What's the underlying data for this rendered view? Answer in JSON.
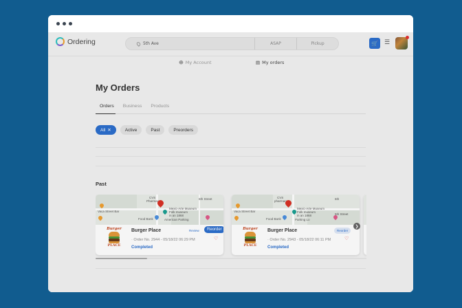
{
  "brand": {
    "name": "Ordering"
  },
  "search": {
    "address": "5th Ave",
    "time": "ASAP",
    "mode": "Pickup"
  },
  "account_nav": {
    "my_account": "My Account",
    "my_orders": "My orders"
  },
  "page_title": "My Orders",
  "tabs": [
    {
      "label": "Orders"
    },
    {
      "label": "Business"
    },
    {
      "label": "Products"
    }
  ],
  "filters": [
    {
      "label": "All"
    },
    {
      "label": "Active"
    },
    {
      "label": "Past"
    },
    {
      "label": "Preorders"
    }
  ],
  "section_title": "Past",
  "map_labels": {
    "cvs": "CVS",
    "pharmacy": "Pharmacy ·",
    "pharmacy2": "pharmacy ·",
    "mexic": "Mexic-Arte Museum",
    "mexic_sub1": "Folk museum",
    "mexic_sub2": "in an 1868",
    "street6": "6th Street",
    "street6b": "6th",
    "street5": "5th Street",
    "vacashort": "Vaca Street Bar",
    "foodbank": "Food Bank",
    "parking": "American Parking",
    "parking_sub": "Parking lot",
    "parking_sub2": "Parking Lo"
  },
  "orders": [
    {
      "store": "Burger Place",
      "logo_text_top": "Burger",
      "logo_text_bottom": "PLACE",
      "order_line": "Order No. 2944 - 05/18/22 06:29 PM",
      "status": "Completed",
      "review_label": "Review",
      "reorder_label": "Reorder"
    },
    {
      "store": "Burger Place",
      "logo_text_top": "Burger",
      "logo_text_bottom": "PLACE",
      "order_line": "Order No. 2943 - 05/18/22 06:11 PM",
      "status": "Completed",
      "review_label": "",
      "reorder_label": "Reorder"
    }
  ],
  "colors": {
    "accent": "#2c6fce",
    "background": "#115c8f",
    "page": "#f2f2f2"
  },
  "icons": {
    "cart": "cart-icon",
    "menu": "menu-icon",
    "next": "chevron-right-icon",
    "heart": "heart-icon",
    "pin": "location-pin-icon"
  }
}
